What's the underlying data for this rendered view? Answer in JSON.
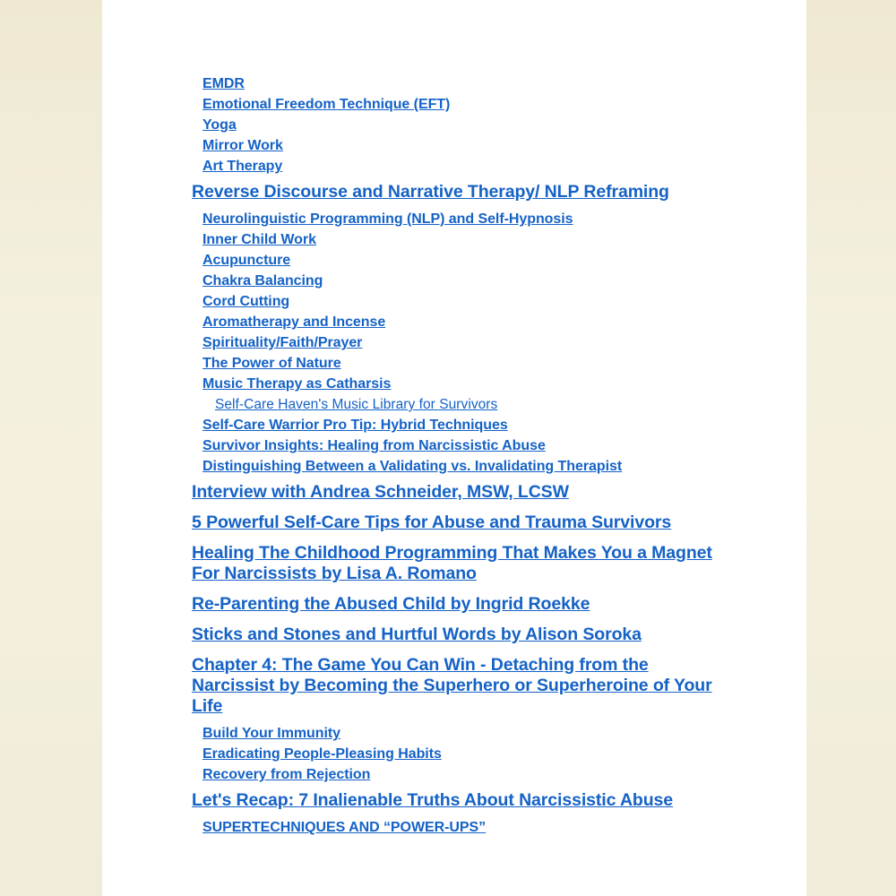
{
  "document": {
    "kind": "table-of-contents",
    "page_background": "#ffffff",
    "canvas_background": "#f2eedc",
    "link_color": "#1562c6"
  },
  "toc": {
    "entries": [
      {
        "id": "emdr",
        "level": 1,
        "bold": true,
        "text": "EMDR"
      },
      {
        "id": "eft",
        "level": 1,
        "bold": true,
        "text": "Emotional Freedom Technique (EFT)"
      },
      {
        "id": "yoga",
        "level": 1,
        "bold": true,
        "text": "Yoga"
      },
      {
        "id": "mirror-work",
        "level": 1,
        "bold": true,
        "text": "Mirror Work"
      },
      {
        "id": "art-therapy",
        "level": 1,
        "bold": true,
        "text": "Art Therapy"
      },
      {
        "id": "reverse-discourse",
        "level": 0,
        "bold": true,
        "text": "Reverse Discourse and Narrative Therapy/ NLP Reframing"
      },
      {
        "id": "nlp-self-hypnosis",
        "level": 1,
        "bold": true,
        "text": "Neurolinguistic Programming (NLP) and Self-Hypnosis"
      },
      {
        "id": "inner-child-work",
        "level": 1,
        "bold": true,
        "text": "Inner Child Work"
      },
      {
        "id": "acupuncture",
        "level": 1,
        "bold": true,
        "text": "Acupuncture"
      },
      {
        "id": "chakra-balancing",
        "level": 1,
        "bold": true,
        "text": "Chakra Balancing"
      },
      {
        "id": "cord-cutting",
        "level": 1,
        "bold": true,
        "text": "Cord Cutting"
      },
      {
        "id": "aromatherapy",
        "level": 1,
        "bold": true,
        "text": "Aromatherapy and Incense"
      },
      {
        "id": "spirituality",
        "level": 1,
        "bold": true,
        "text": "Spirituality/Faith/Prayer"
      },
      {
        "id": "power-of-nature",
        "level": 1,
        "bold": true,
        "text": "The Power of Nature"
      },
      {
        "id": "music-therapy",
        "level": 1,
        "bold": true,
        "text": "Music Therapy as Catharsis"
      },
      {
        "id": "music-library",
        "level": 2,
        "bold": false,
        "text": "Self-Care Haven's Music Library for Survivors"
      },
      {
        "id": "hybrid-techniques",
        "level": 1,
        "bold": true,
        "text": "Self-Care Warrior Pro Tip: Hybrid Techniques"
      },
      {
        "id": "survivor-insights",
        "level": 1,
        "bold": true,
        "text": "Survivor Insights: Healing from Narcissistic Abuse"
      },
      {
        "id": "validating-therapist",
        "level": 1,
        "bold": true,
        "text": "Distinguishing Between a Validating vs. Invalidating Therapist"
      },
      {
        "id": "andrea-schneider",
        "level": 0,
        "bold": true,
        "text": "Interview with Andrea Schneider, MSW, LCSW"
      },
      {
        "id": "five-tips",
        "level": 0,
        "bold": true,
        "text": "5 Powerful Self-Care Tips for Abuse and Trauma Survivors"
      },
      {
        "id": "lisa-romano",
        "level": 0,
        "bold": true,
        "text": "Healing The Childhood Programming That Makes You a Magnet For Narcissists by Lisa A. Romano"
      },
      {
        "id": "ingrid-roekke",
        "level": 0,
        "bold": true,
        "text": "Re-Parenting the Abused Child by Ingrid Roekke"
      },
      {
        "id": "alison-soroka",
        "level": 0,
        "bold": true,
        "text": "Sticks and Stones and Hurtful Words by Alison Soroka"
      },
      {
        "id": "chapter-4",
        "level": 0,
        "bold": true,
        "text": "Chapter 4: The Game You Can Win - Detaching from the Narcissist by Becoming the Superhero or Superheroine of Your Life"
      },
      {
        "id": "build-immunity",
        "level": 1,
        "bold": true,
        "text": "Build Your Immunity"
      },
      {
        "id": "people-pleasing",
        "level": 1,
        "bold": true,
        "text": "Eradicating People-Pleasing Habits"
      },
      {
        "id": "recovery-rejection",
        "level": 1,
        "bold": true,
        "text": "Recovery from Rejection"
      },
      {
        "id": "lets-recap",
        "level": 0,
        "bold": true,
        "text": "Let's Recap: 7 Inalienable Truths About Narcissistic Abuse"
      },
      {
        "id": "supertechniques",
        "level": 1,
        "bold": true,
        "text": "SUPERTECHNIQUES AND “POWER-UPS”"
      }
    ]
  }
}
